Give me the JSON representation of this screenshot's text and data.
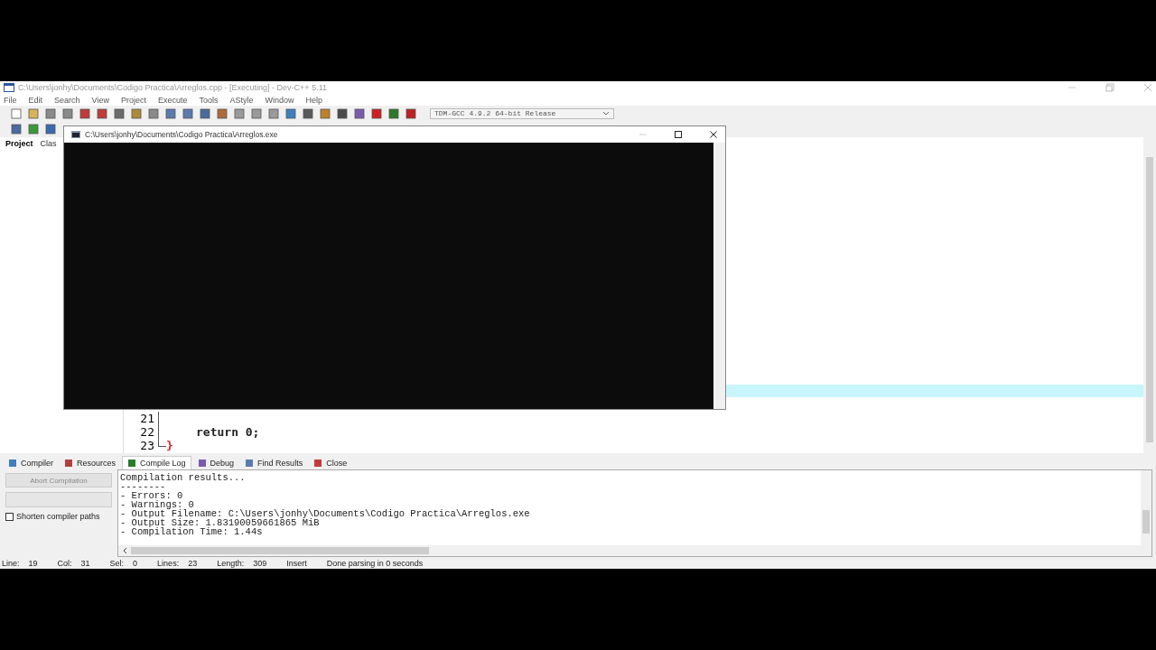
{
  "window": {
    "title": "C:\\Users\\jonhy\\Documents\\Codigo Practica\\Arreglos.cpp - [Executing] - Dev-C++ 5.11"
  },
  "menu": [
    "File",
    "Edit",
    "Search",
    "View",
    "Project",
    "Execute",
    "Tools",
    "AStyle",
    "Window",
    "Help"
  ],
  "compiler_select": {
    "value": "TDM-GCC 4.9.2 64-bit Release"
  },
  "side_tabs": [
    {
      "label": "Project",
      "selected": true
    },
    {
      "label": "Clas",
      "selected": false
    }
  ],
  "editor": {
    "current_line_highlight": true,
    "lines": [
      {
        "number": "21"
      },
      {
        "number": "22",
        "code": "return 0;"
      },
      {
        "number": "23",
        "code": "}"
      }
    ]
  },
  "console": {
    "title": "C:\\Users\\jonhy\\Documents\\Codigo Practica\\Arreglos.exe"
  },
  "bottom_tabs": [
    {
      "label": "Compiler",
      "selected": false
    },
    {
      "label": "Resources",
      "selected": false
    },
    {
      "label": "Compile Log",
      "selected": true
    },
    {
      "label": "Debug",
      "selected": false
    },
    {
      "label": "Find Results",
      "selected": false
    },
    {
      "label": "Close",
      "selected": false
    }
  ],
  "abort_button": {
    "label": "Abort Compilation",
    "disabled": true
  },
  "shorten_paths": {
    "label": "Shorten compiler paths",
    "checked": false
  },
  "log": [
    "Compilation results...",
    "--------",
    "- Errors: 0",
    "- Warnings: 0",
    "- Output Filename: C:\\Users\\jonhy\\Documents\\Codigo Practica\\Arreglos.exe",
    "- Output Size: 1.83190059661865 MiB",
    "- Compilation Time: 1.44s"
  ],
  "status_bar": [
    {
      "label": "Line:",
      "value": "19"
    },
    {
      "label": "Col:",
      "value": "31"
    },
    {
      "label": "Sel:",
      "value": "0"
    },
    {
      "label": "Lines:",
      "value": "23"
    },
    {
      "label": "Length:",
      "value": "309"
    },
    {
      "value": "Insert"
    },
    {
      "value": "Done parsing in 0 seconds"
    }
  ]
}
